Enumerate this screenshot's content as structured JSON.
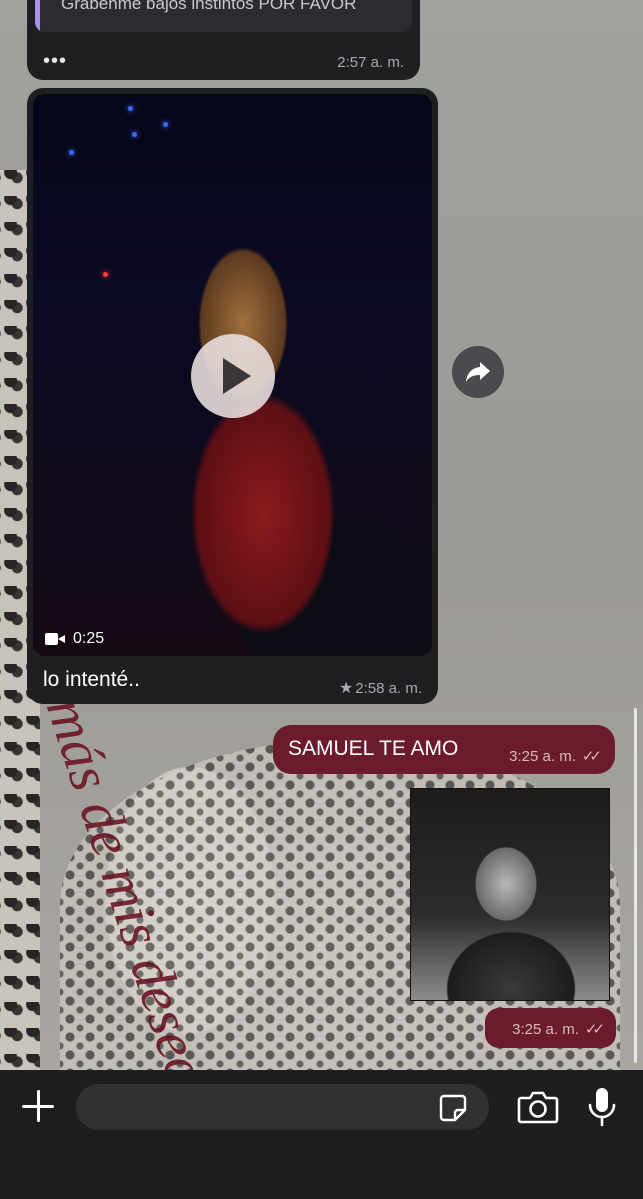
{
  "chat": {
    "messages": [
      {
        "type": "incoming-text-partial",
        "quote_text": "Grabenme bajos instintos POR FAVOR",
        "more": "•••",
        "time": "2:57 a. m."
      },
      {
        "type": "incoming-video",
        "duration": "0:25",
        "caption": "lo intenté..",
        "starred": "★",
        "time": "2:58 a. m."
      },
      {
        "type": "outgoing-text",
        "text": "SAMUEL TE AMO",
        "time": "3:25 a. m.",
        "ticks": "✓✓"
      },
      {
        "type": "outgoing-sticker",
        "time": "3:25 a. m.",
        "ticks": "✓✓"
      }
    ],
    "wallpaper_text": "más de mis deseos"
  },
  "composer": {
    "placeholder": "",
    "value": ""
  },
  "icons": {
    "play": "play-icon",
    "video_camera": "video-camera-icon",
    "forward": "forward-icon",
    "plus": "plus-icon",
    "sticker": "sticker-icon",
    "camera": "camera-icon",
    "mic": "microphone-icon"
  },
  "colors": {
    "outgoing_bubble": "#6b1b2c",
    "incoming_bubble": "#1e1f21",
    "quote_accent": "#a98ff0",
    "composer_bg": "#1d1e20"
  }
}
